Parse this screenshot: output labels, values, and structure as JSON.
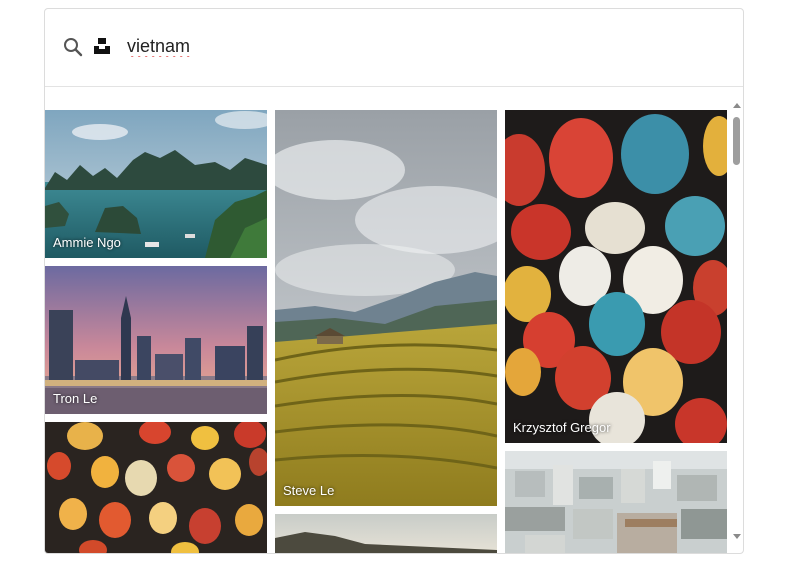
{
  "search": {
    "value": "vietnam",
    "search_icon": "search-icon",
    "logo_icon": "unsplash-logo-icon"
  },
  "photos": [
    {
      "credit": "Ammie Ngo",
      "subject": "halong-bay"
    },
    {
      "credit": "Tron Le",
      "subject": "saigon-skyline"
    },
    {
      "credit": "",
      "subject": "lanterns"
    },
    {
      "credit": "Steve Le",
      "subject": "rice-terraces"
    },
    {
      "credit": "",
      "subject": "misty-hills"
    },
    {
      "credit": "Krzysztof Gregor",
      "subject": "hoi-an-lanterns"
    },
    {
      "credit": "",
      "subject": "city-aerial"
    }
  ],
  "colors": {
    "border": "#dcdcdc",
    "scrollbar_thumb": "#9e9e9e"
  }
}
